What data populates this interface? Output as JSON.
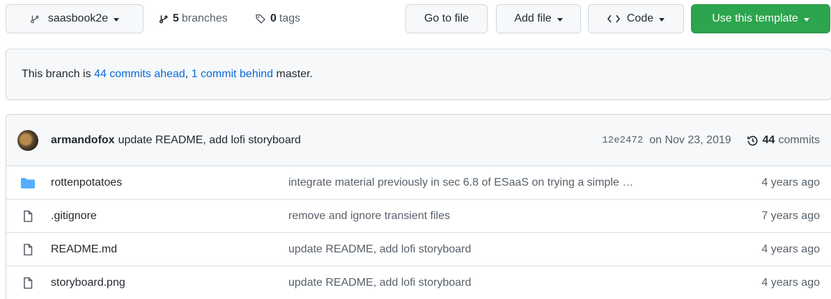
{
  "toolbar": {
    "branch": "saasbook2e",
    "branches_count": "5",
    "branches_label": "branches",
    "tags_count": "0",
    "tags_label": "tags",
    "go_to_file": "Go to file",
    "add_file": "Add file",
    "code": "Code",
    "use_template": "Use this template"
  },
  "flash": {
    "prefix": "This branch is",
    "ahead": "44 commits ahead",
    "sep": ",",
    "behind": "1 commit behind",
    "suffix": "master."
  },
  "latest_commit": {
    "author": "armandofox",
    "message": "update README, add lofi storyboard",
    "sha": "12e2472",
    "date": "on Nov 23, 2019",
    "commits_count": "44",
    "commits_label": "commits"
  },
  "files": [
    {
      "name": "rottenpotatoes",
      "type": "folder-icon",
      "message": "integrate material previously in sec 6.8 of ESaaS on trying a simple …",
      "age": "4 years ago"
    },
    {
      "name": ".gitignore",
      "type": "file-icon",
      "message": "remove and ignore transient files",
      "age": "7 years ago"
    },
    {
      "name": "README.md",
      "type": "file-icon",
      "message": "update README, add lofi storyboard",
      "age": "4 years ago"
    },
    {
      "name": "storyboard.png",
      "type": "file-icon",
      "message": "update README, add lofi storyboard",
      "age": "4 years ago"
    }
  ],
  "colors": {
    "primary_button": "#2da44e",
    "link": "#0969da",
    "folder": "#54aeff"
  }
}
